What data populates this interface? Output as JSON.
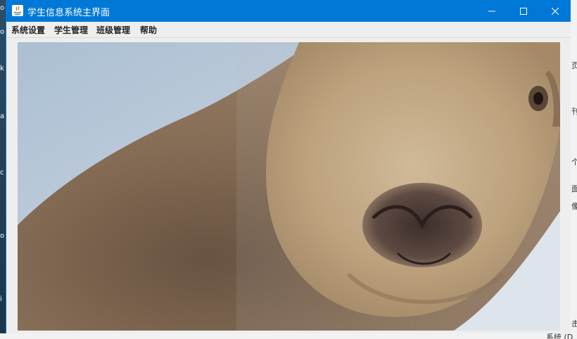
{
  "window": {
    "title": "学生信息系统主界面",
    "accent_color": "#0078d7",
    "controls": {
      "minimize_icon": "minimize-icon",
      "maximize_icon": "maximize-icon",
      "close_icon": "close-icon"
    }
  },
  "menubar": {
    "items": [
      {
        "label": "系统设置"
      },
      {
        "label": "学生管理"
      },
      {
        "label": "班级管理"
      },
      {
        "label": "帮助"
      }
    ]
  },
  "content": {
    "image": "sheep-photo"
  },
  "desktop": {
    "taskbar_fragment": "系统 (D"
  }
}
